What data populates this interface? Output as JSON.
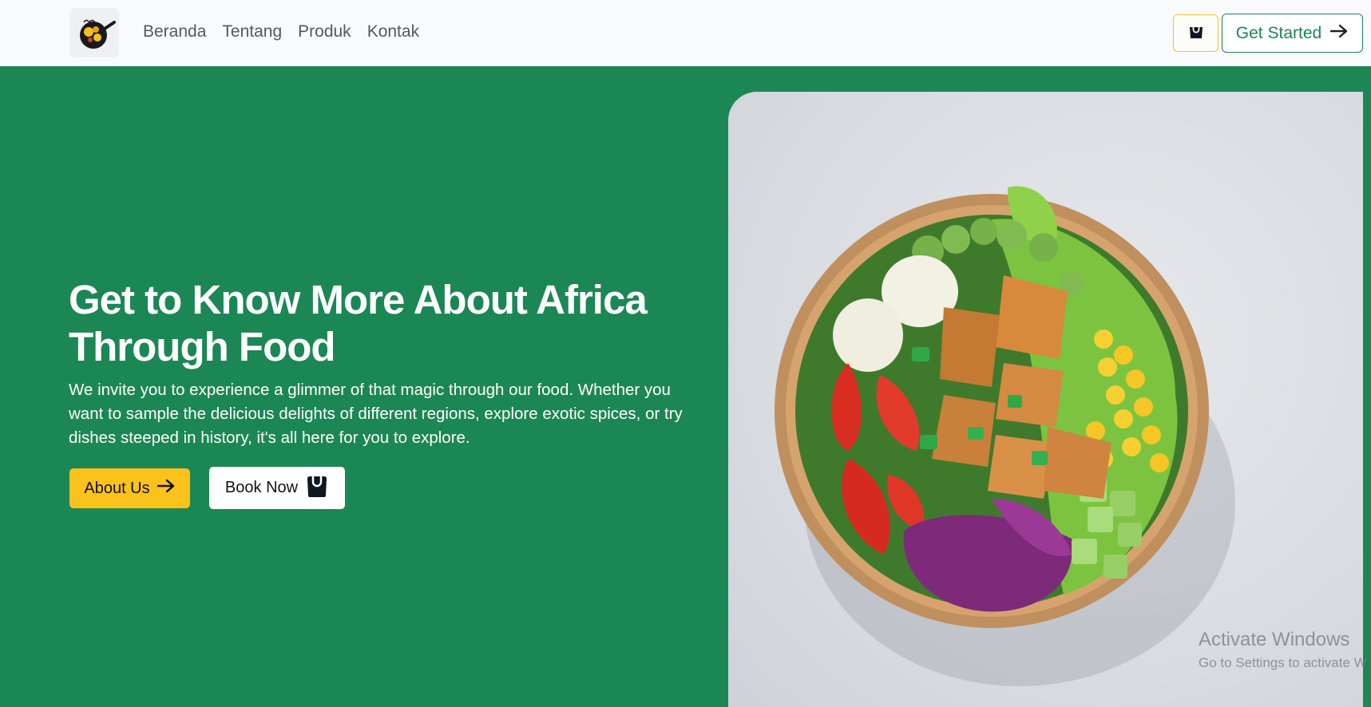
{
  "nav": {
    "links": [
      "Beranda",
      "Tentang",
      "Produk",
      "Kontak"
    ],
    "get_started_label": "Get Started"
  },
  "hero": {
    "title_line1": "Get to Know More About Africa",
    "title_line2": "Through Food",
    "description": "We invite you to experience a glimmer of that magic through our food. Whether you want to sample the delicious delights of different regions, explore exotic spices, or try dishes steeped in history, it's all here for you to explore.",
    "about_label": "About Us",
    "book_label": "Book Now"
  },
  "watermark": {
    "title": "Activate Windows",
    "subtitle": "Go to Settings to activate W"
  },
  "colors": {
    "brand_green": "#1b8754",
    "accent_yellow": "#fbc21b",
    "navbar_bg": "#f9fafb"
  },
  "icons": [
    "logo-icon",
    "shopping-bag-icon",
    "arrow-right-icon"
  ]
}
